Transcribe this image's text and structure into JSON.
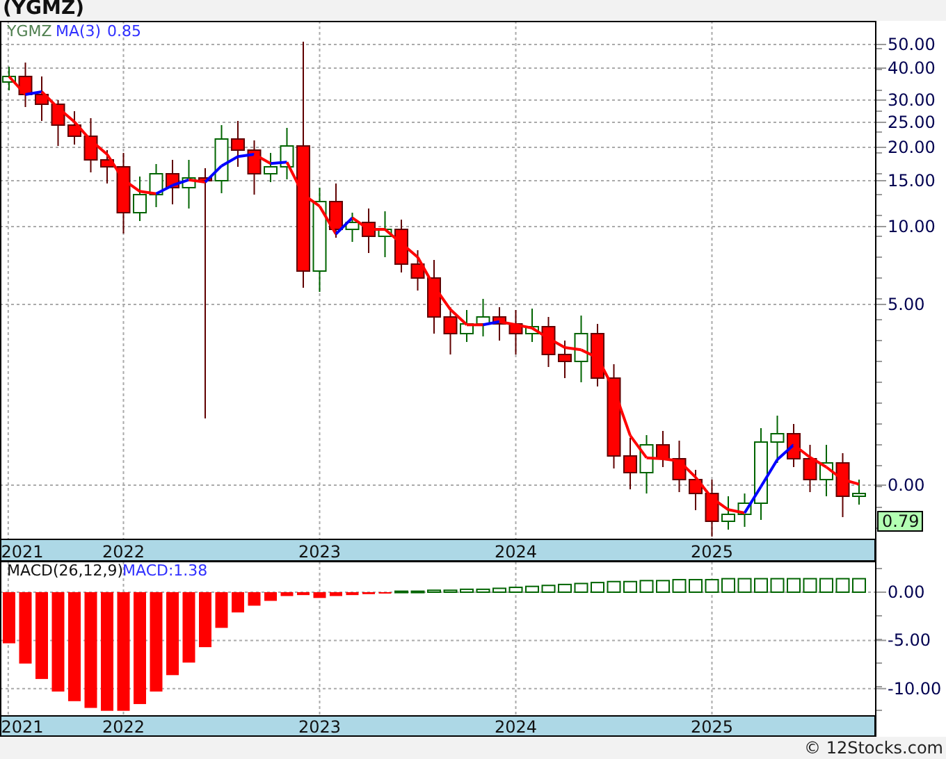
{
  "title": "(YGMZ)",
  "price_panel": {
    "legend": {
      "symbol": "YGMZ",
      "indicator": "MA(3)",
      "value": "0.85"
    },
    "y_labels": [
      "50.00",
      "40.00",
      "30.00",
      "25.00",
      "20.00",
      "15.00",
      "10.00",
      "5.00",
      "0.00"
    ],
    "last_price": "0.79",
    "x_labels": [
      "2021",
      "2022",
      "2023",
      "2024",
      "2025"
    ]
  },
  "macd_panel": {
    "legend": {
      "name": "MACD(26,12,9)",
      "value": "MACD:1.38"
    },
    "chart_data": {
      "type": "bar",
      "values": [
        -5.3,
        -7.4,
        -9,
        -10.3,
        -11.3,
        -12,
        -12.3,
        -12.3,
        -11.6,
        -10.3,
        -8.6,
        -7.3,
        -5.7,
        -3.7,
        -2.1,
        -1.4,
        -0.9,
        -0.4,
        -0.3,
        -0.6,
        -0.4,
        -0.3,
        -0.2,
        -0.1,
        0.1,
        0.1,
        0.2,
        0.2,
        0.3,
        0.3,
        0.4,
        0.5,
        0.6,
        0.7,
        0.8,
        0.9,
        1.0,
        1.1,
        1.1,
        1.2,
        1.2,
        1.3,
        1.3,
        1.3,
        1.4,
        1.4,
        1.4,
        1.4,
        1.4,
        1.4,
        1.4,
        1.4,
        1.4
      ],
      "grid": true,
      "ylim": [
        -12.8,
        3.2
      ],
      "yticks": [
        {
          "value": 0,
          "label": "0.00"
        },
        {
          "value": -5,
          "label": "-5.00"
        },
        {
          "value": -10,
          "label": "-10.00"
        }
      ]
    },
    "x_labels": [
      "2021",
      "2022",
      "2023",
      "2024",
      "2025"
    ]
  },
  "credit": "© 12Stocks.com"
}
